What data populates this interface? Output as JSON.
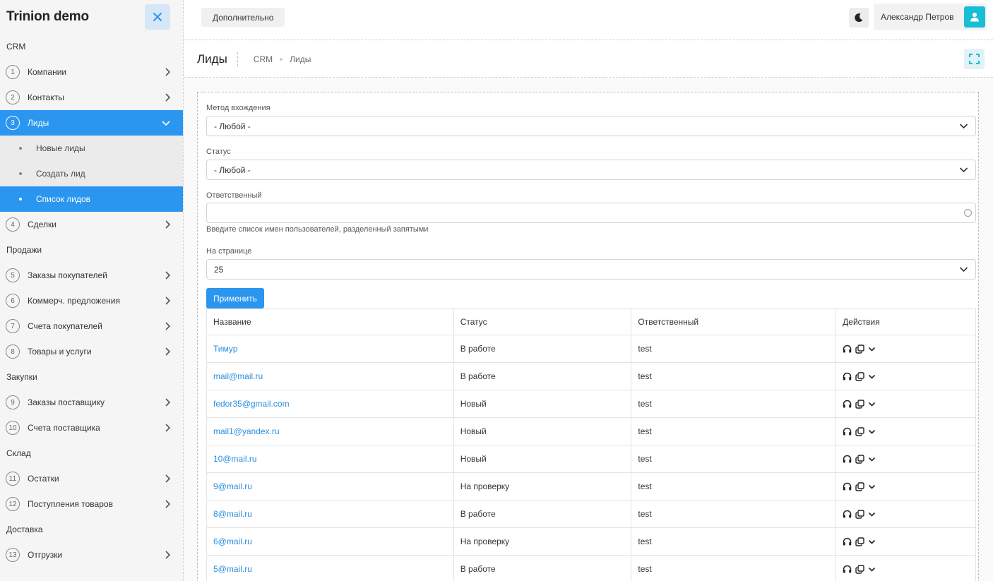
{
  "app": {
    "title": "Trinion demo"
  },
  "sidebar": {
    "sections": [
      {
        "title": "CRM"
      },
      {
        "title": "Продажи"
      },
      {
        "title": "Закупки"
      },
      {
        "title": "Склад"
      },
      {
        "title": "Доставка"
      }
    ],
    "items": [
      {
        "num": "1",
        "label": "Компании"
      },
      {
        "num": "2",
        "label": "Контакты"
      },
      {
        "num": "3",
        "label": "Лиды"
      },
      {
        "num": "4",
        "label": "Сделки"
      },
      {
        "num": "5",
        "label": "Заказы покупателей"
      },
      {
        "num": "6",
        "label": "Коммерч. предложения"
      },
      {
        "num": "7",
        "label": "Счета покупателей"
      },
      {
        "num": "8",
        "label": "Товары и услуги"
      },
      {
        "num": "9",
        "label": "Заказы поставщику"
      },
      {
        "num": "10",
        "label": "Счета поставщика"
      },
      {
        "num": "11",
        "label": "Остатки"
      },
      {
        "num": "12",
        "label": "Поступления товаров"
      },
      {
        "num": "13",
        "label": "Отгрузки"
      }
    ],
    "subitems": [
      {
        "label": "Новые лиды"
      },
      {
        "label": "Создать лид"
      },
      {
        "label": "Список лидов"
      }
    ],
    "accent_color": "#2b96f0"
  },
  "topbar": {
    "extra_button": "Дополнительно",
    "user_name": "Александр Петров"
  },
  "page": {
    "title": "Лиды",
    "breadcrumbs": [
      "CRM",
      "Лиды"
    ]
  },
  "filters": {
    "method_label": "Метод вхождения",
    "method_value": "- Любой -",
    "status_label": "Статус",
    "status_value": "- Любой -",
    "responsible_label": "Ответственный",
    "responsible_value": "",
    "responsible_hint": "Введите список имен пользователей, разделенный запятыми",
    "per_page_label": "На странице",
    "per_page_value": "25",
    "apply_button": "Применить"
  },
  "table": {
    "headers": [
      "Название",
      "Статус",
      "Ответственный",
      "Действия"
    ],
    "rows": [
      {
        "name": "Тимур",
        "status": "В работе",
        "owner": "test"
      },
      {
        "name": "mail@mail.ru",
        "status": "В работе",
        "owner": "test"
      },
      {
        "name": "fedor35@gmail.com",
        "status": "Новый",
        "owner": "test"
      },
      {
        "name": "mail1@yandex.ru",
        "status": "Новый",
        "owner": "test"
      },
      {
        "name": "10@mail.ru",
        "status": "Новый",
        "owner": "test"
      },
      {
        "name": "9@mail.ru",
        "status": "На проверку",
        "owner": "test"
      },
      {
        "name": "8@mail.ru",
        "status": "В работе",
        "owner": "test"
      },
      {
        "name": "6@mail.ru",
        "status": "На проверку",
        "owner": "test"
      },
      {
        "name": "5@mail.ru",
        "status": "В работе",
        "owner": "test"
      }
    ],
    "action_icons": [
      "headset-icon",
      "copy-icon",
      "chevron-down-icon"
    ]
  }
}
